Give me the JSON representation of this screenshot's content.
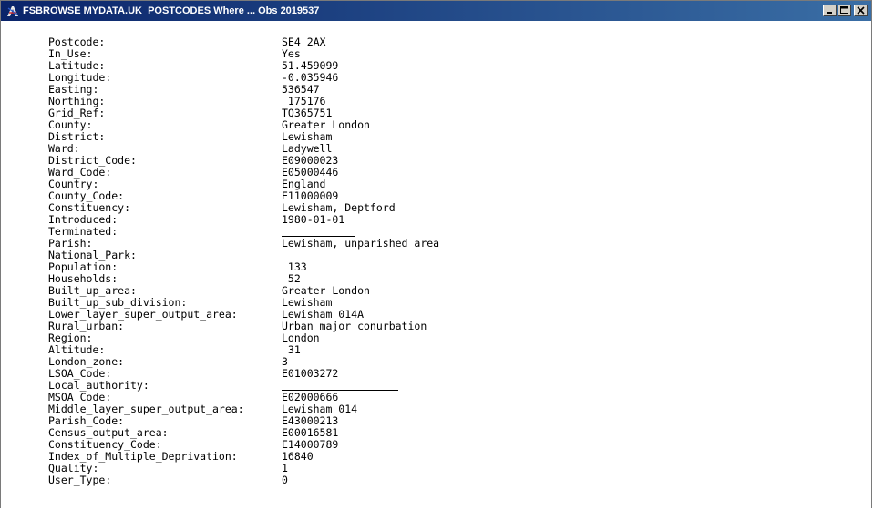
{
  "window": {
    "title": "FSBROWSE MYDATA.UK_POSTCODES  Where ... Obs 2019537"
  },
  "fields": [
    {
      "label": "Postcode:",
      "value": "SE4 2AX"
    },
    {
      "label": "In_Use:",
      "value": "Yes"
    },
    {
      "label": "Latitude:",
      "value": "51.459099"
    },
    {
      "label": "Longitude:",
      "value": "-0.035946"
    },
    {
      "label": "Easting:",
      "value": "536547"
    },
    {
      "label": "Northing:",
      "value": " 175176"
    },
    {
      "label": "Grid_Ref:",
      "value": "TQ365751"
    },
    {
      "label": "County:",
      "value": "Greater London"
    },
    {
      "label": "District:",
      "value": "Lewisham"
    },
    {
      "label": "Ward:",
      "value": "Ladywell"
    },
    {
      "label": "District_Code:",
      "value": "E09000023"
    },
    {
      "label": "Ward_Code:",
      "value": "E05000446"
    },
    {
      "label": "Country:",
      "value": "England"
    },
    {
      "label": "County_Code:",
      "value": "E11000009"
    },
    {
      "label": "Constituency:",
      "value": "Lewisham, Deptford"
    },
    {
      "label": "Introduced:",
      "value": "1980-01-01"
    },
    {
      "label": "Terminated:",
      "value": ""
    },
    {
      "label": "Parish:",
      "value": "Lewisham, unparished area"
    },
    {
      "label": "National_Park:",
      "value": ""
    },
    {
      "label": "Population:",
      "value": " 133"
    },
    {
      "label": "Households:",
      "value": " 52"
    },
    {
      "label": "Built_up_area:",
      "value": "Greater London"
    },
    {
      "label": "Built_up_sub_division:",
      "value": "Lewisham"
    },
    {
      "label": "Lower_layer_super_output_area:",
      "value": "Lewisham 014A"
    },
    {
      "label": "Rural_urban:",
      "value": "Urban major conurbation"
    },
    {
      "label": "Region:",
      "value": "London"
    },
    {
      "label": "Altitude:",
      "value": " 31"
    },
    {
      "label": "London_zone:",
      "value": "3"
    },
    {
      "label": "LSOA_Code:",
      "value": "E01003272"
    },
    {
      "label": "Local_authority:",
      "value": ""
    },
    {
      "label": "MSOA_Code:",
      "value": "E02000666"
    },
    {
      "label": "Middle_layer_super_output_area:",
      "value": "Lewisham 014"
    },
    {
      "label": "Parish_Code:",
      "value": "E43000213"
    },
    {
      "label": "Census_output_area:",
      "value": "E00016581"
    },
    {
      "label": "Constituency_Code:",
      "value": "E14000789"
    },
    {
      "label": "Index_of_Multiple_Deprivation:",
      "value": "16840"
    },
    {
      "label": "Quality:",
      "value": "1"
    },
    {
      "label": "User_Type:",
      "value": "0"
    }
  ]
}
